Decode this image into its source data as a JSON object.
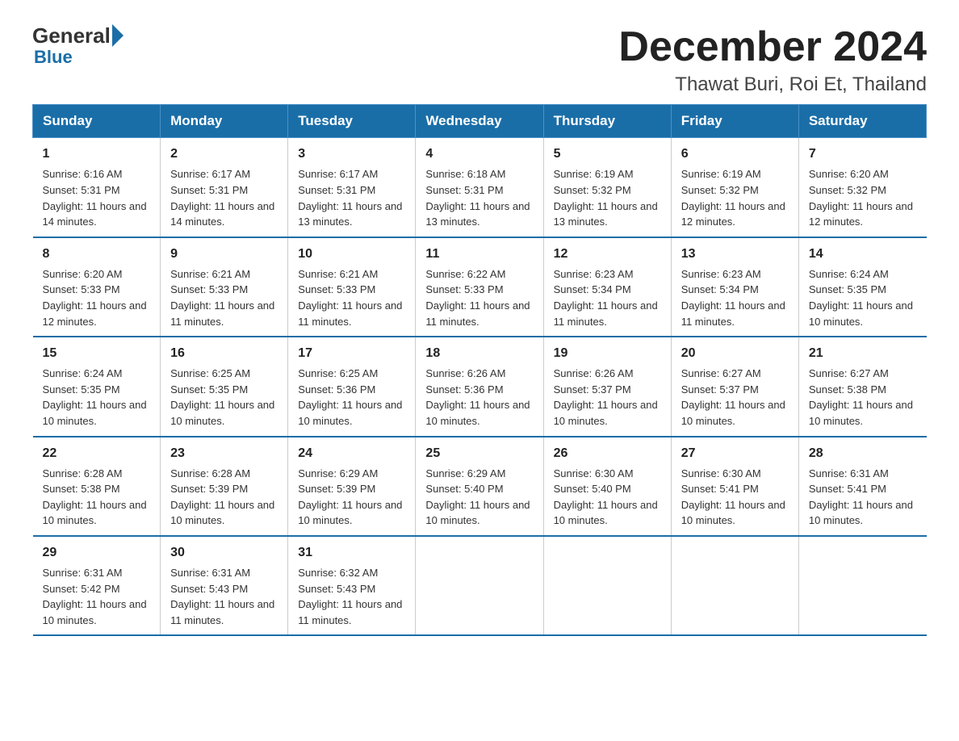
{
  "logo": {
    "general": "General",
    "blue": "Blue"
  },
  "header": {
    "month": "December 2024",
    "location": "Thawat Buri, Roi Et, Thailand"
  },
  "days_of_week": [
    "Sunday",
    "Monday",
    "Tuesday",
    "Wednesday",
    "Thursday",
    "Friday",
    "Saturday"
  ],
  "weeks": [
    [
      {
        "day": "1",
        "sunrise": "Sunrise: 6:16 AM",
        "sunset": "Sunset: 5:31 PM",
        "daylight": "Daylight: 11 hours and 14 minutes."
      },
      {
        "day": "2",
        "sunrise": "Sunrise: 6:17 AM",
        "sunset": "Sunset: 5:31 PM",
        "daylight": "Daylight: 11 hours and 14 minutes."
      },
      {
        "day": "3",
        "sunrise": "Sunrise: 6:17 AM",
        "sunset": "Sunset: 5:31 PM",
        "daylight": "Daylight: 11 hours and 13 minutes."
      },
      {
        "day": "4",
        "sunrise": "Sunrise: 6:18 AM",
        "sunset": "Sunset: 5:31 PM",
        "daylight": "Daylight: 11 hours and 13 minutes."
      },
      {
        "day": "5",
        "sunrise": "Sunrise: 6:19 AM",
        "sunset": "Sunset: 5:32 PM",
        "daylight": "Daylight: 11 hours and 13 minutes."
      },
      {
        "day": "6",
        "sunrise": "Sunrise: 6:19 AM",
        "sunset": "Sunset: 5:32 PM",
        "daylight": "Daylight: 11 hours and 12 minutes."
      },
      {
        "day": "7",
        "sunrise": "Sunrise: 6:20 AM",
        "sunset": "Sunset: 5:32 PM",
        "daylight": "Daylight: 11 hours and 12 minutes."
      }
    ],
    [
      {
        "day": "8",
        "sunrise": "Sunrise: 6:20 AM",
        "sunset": "Sunset: 5:33 PM",
        "daylight": "Daylight: 11 hours and 12 minutes."
      },
      {
        "day": "9",
        "sunrise": "Sunrise: 6:21 AM",
        "sunset": "Sunset: 5:33 PM",
        "daylight": "Daylight: 11 hours and 11 minutes."
      },
      {
        "day": "10",
        "sunrise": "Sunrise: 6:21 AM",
        "sunset": "Sunset: 5:33 PM",
        "daylight": "Daylight: 11 hours and 11 minutes."
      },
      {
        "day": "11",
        "sunrise": "Sunrise: 6:22 AM",
        "sunset": "Sunset: 5:33 PM",
        "daylight": "Daylight: 11 hours and 11 minutes."
      },
      {
        "day": "12",
        "sunrise": "Sunrise: 6:23 AM",
        "sunset": "Sunset: 5:34 PM",
        "daylight": "Daylight: 11 hours and 11 minutes."
      },
      {
        "day": "13",
        "sunrise": "Sunrise: 6:23 AM",
        "sunset": "Sunset: 5:34 PM",
        "daylight": "Daylight: 11 hours and 11 minutes."
      },
      {
        "day": "14",
        "sunrise": "Sunrise: 6:24 AM",
        "sunset": "Sunset: 5:35 PM",
        "daylight": "Daylight: 11 hours and 10 minutes."
      }
    ],
    [
      {
        "day": "15",
        "sunrise": "Sunrise: 6:24 AM",
        "sunset": "Sunset: 5:35 PM",
        "daylight": "Daylight: 11 hours and 10 minutes."
      },
      {
        "day": "16",
        "sunrise": "Sunrise: 6:25 AM",
        "sunset": "Sunset: 5:35 PM",
        "daylight": "Daylight: 11 hours and 10 minutes."
      },
      {
        "day": "17",
        "sunrise": "Sunrise: 6:25 AM",
        "sunset": "Sunset: 5:36 PM",
        "daylight": "Daylight: 11 hours and 10 minutes."
      },
      {
        "day": "18",
        "sunrise": "Sunrise: 6:26 AM",
        "sunset": "Sunset: 5:36 PM",
        "daylight": "Daylight: 11 hours and 10 minutes."
      },
      {
        "day": "19",
        "sunrise": "Sunrise: 6:26 AM",
        "sunset": "Sunset: 5:37 PM",
        "daylight": "Daylight: 11 hours and 10 minutes."
      },
      {
        "day": "20",
        "sunrise": "Sunrise: 6:27 AM",
        "sunset": "Sunset: 5:37 PM",
        "daylight": "Daylight: 11 hours and 10 minutes."
      },
      {
        "day": "21",
        "sunrise": "Sunrise: 6:27 AM",
        "sunset": "Sunset: 5:38 PM",
        "daylight": "Daylight: 11 hours and 10 minutes."
      }
    ],
    [
      {
        "day": "22",
        "sunrise": "Sunrise: 6:28 AM",
        "sunset": "Sunset: 5:38 PM",
        "daylight": "Daylight: 11 hours and 10 minutes."
      },
      {
        "day": "23",
        "sunrise": "Sunrise: 6:28 AM",
        "sunset": "Sunset: 5:39 PM",
        "daylight": "Daylight: 11 hours and 10 minutes."
      },
      {
        "day": "24",
        "sunrise": "Sunrise: 6:29 AM",
        "sunset": "Sunset: 5:39 PM",
        "daylight": "Daylight: 11 hours and 10 minutes."
      },
      {
        "day": "25",
        "sunrise": "Sunrise: 6:29 AM",
        "sunset": "Sunset: 5:40 PM",
        "daylight": "Daylight: 11 hours and 10 minutes."
      },
      {
        "day": "26",
        "sunrise": "Sunrise: 6:30 AM",
        "sunset": "Sunset: 5:40 PM",
        "daylight": "Daylight: 11 hours and 10 minutes."
      },
      {
        "day": "27",
        "sunrise": "Sunrise: 6:30 AM",
        "sunset": "Sunset: 5:41 PM",
        "daylight": "Daylight: 11 hours and 10 minutes."
      },
      {
        "day": "28",
        "sunrise": "Sunrise: 6:31 AM",
        "sunset": "Sunset: 5:41 PM",
        "daylight": "Daylight: 11 hours and 10 minutes."
      }
    ],
    [
      {
        "day": "29",
        "sunrise": "Sunrise: 6:31 AM",
        "sunset": "Sunset: 5:42 PM",
        "daylight": "Daylight: 11 hours and 10 minutes."
      },
      {
        "day": "30",
        "sunrise": "Sunrise: 6:31 AM",
        "sunset": "Sunset: 5:43 PM",
        "daylight": "Daylight: 11 hours and 11 minutes."
      },
      {
        "day": "31",
        "sunrise": "Sunrise: 6:32 AM",
        "sunset": "Sunset: 5:43 PM",
        "daylight": "Daylight: 11 hours and 11 minutes."
      },
      null,
      null,
      null,
      null
    ]
  ]
}
